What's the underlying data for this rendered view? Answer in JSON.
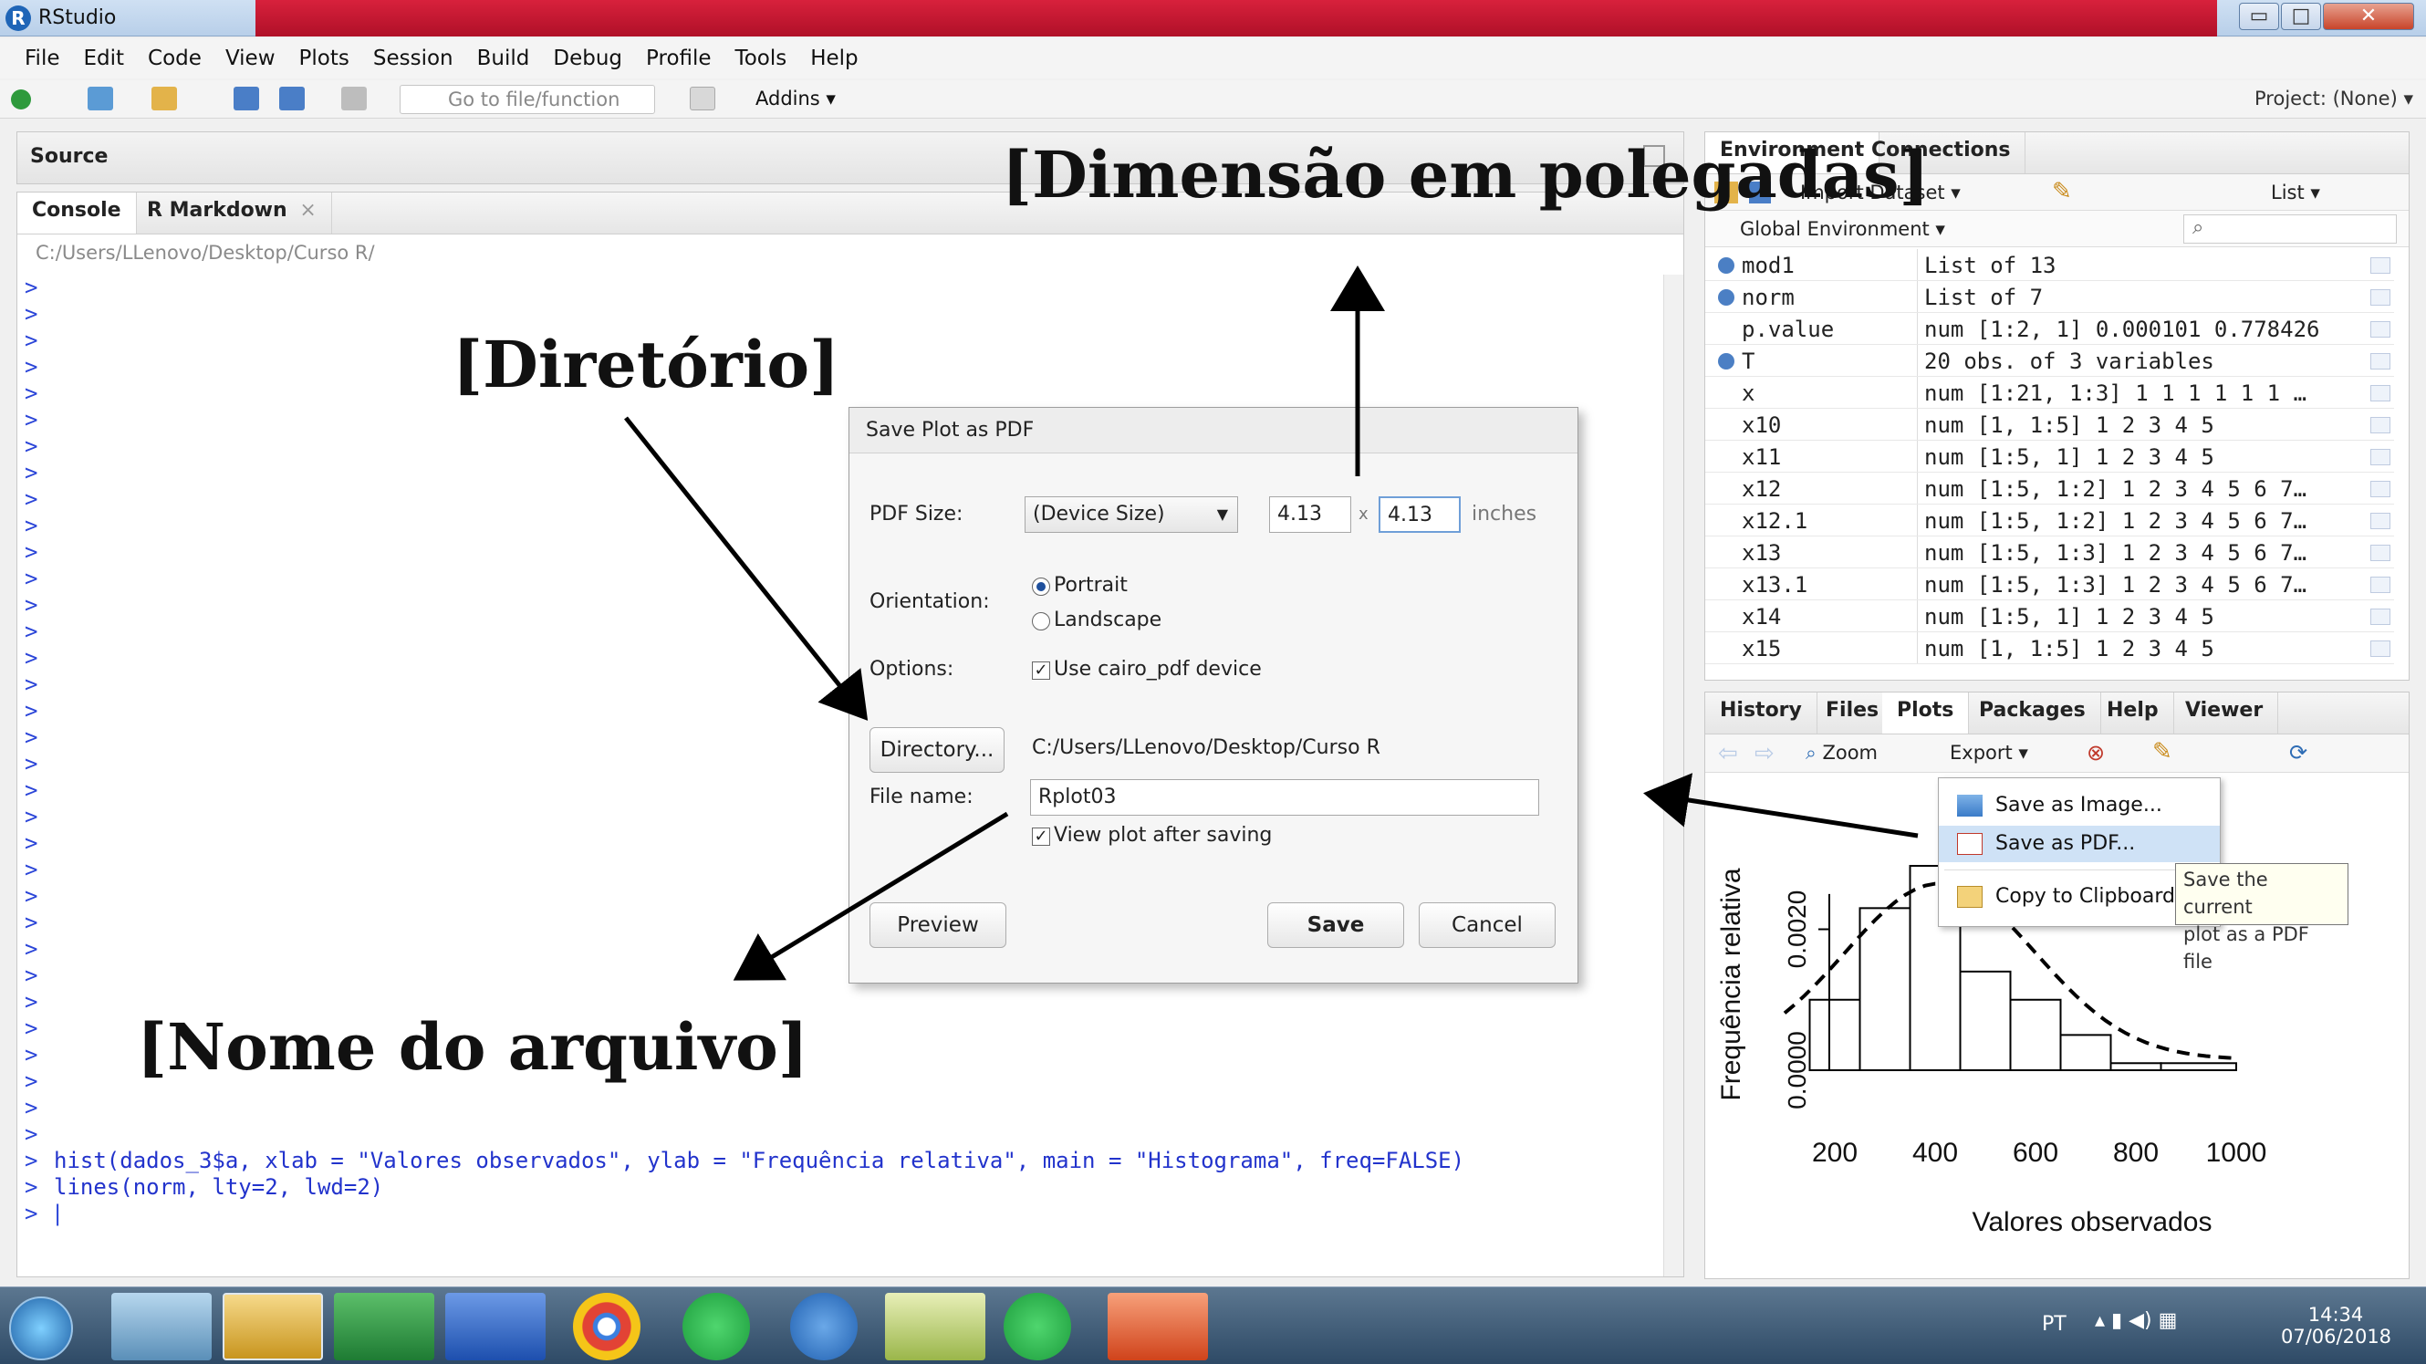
{
  "window": {
    "title": "RStudio",
    "buttons": {
      "minimize": "▭",
      "maximize": "□",
      "close": "✕"
    }
  },
  "menu": [
    "File",
    "Edit",
    "Code",
    "View",
    "Plots",
    "Session",
    "Build",
    "Debug",
    "Profile",
    "Tools",
    "Help"
  ],
  "toolbar": {
    "goto_placeholder": "Go to file/function",
    "addins": "Addins ▾",
    "project": "Project: (None) ▾"
  },
  "source": {
    "title": "Source"
  },
  "console": {
    "tabs": [
      "Console",
      "R Markdown"
    ],
    "path": "C:/Users/LLenovo/Desktop/Curso R/",
    "prompt": ">",
    "commands": [
      "hist(dados_3$a, xlab = \"Valores observados\", ylab = \"Frequência relativa\", main = \"Histograma\", freq=FALSE)",
      "lines(norm, lty=2, lwd=2)"
    ]
  },
  "environment": {
    "tabs": [
      "Environment",
      "Connections"
    ],
    "import": "Import Dataset ▾",
    "list_view": "List ▾",
    "scope": "Global Environment ▾",
    "rows": [
      {
        "name": "mod1",
        "value": "List of 13"
      },
      {
        "name": "norm",
        "value": "List of 7"
      },
      {
        "name": "p.value",
        "value": "num [1:2, 1] 0.000101 0.778426"
      },
      {
        "name": "T",
        "value": "20 obs. of 3 variables"
      },
      {
        "name": "x",
        "value": "num [1:21, 1:3] 1 1 1 1 1 1 …"
      },
      {
        "name": "x10",
        "value": "num [1, 1:5] 1 2 3 4 5"
      },
      {
        "name": "x11",
        "value": "num [1:5, 1] 1 2 3 4 5"
      },
      {
        "name": "x12",
        "value": "num [1:5, 1:2] 1 2 3 4 5 6 7…"
      },
      {
        "name": "x12.1",
        "value": "num [1:5, 1:2] 1 2 3 4 5 6 7…"
      },
      {
        "name": "x13",
        "value": "num [1:5, 1:3] 1 2 3 4 5 6 7…"
      },
      {
        "name": "x13.1",
        "value": "num [1:5, 1:3] 1 2 3 4 5 6 7…"
      },
      {
        "name": "x14",
        "value": "num [1:5, 1] 1 2 3 4 5"
      },
      {
        "name": "x15",
        "value": "num [1, 1:5] 1 2 3 4 5"
      }
    ]
  },
  "plots": {
    "tabs": [
      "History",
      "Files",
      "Plots",
      "Packages",
      "Help",
      "Viewer"
    ],
    "zoom": "Zoom",
    "export": "Export ▾",
    "export_menu": [
      "Save as Image...",
      "Save as PDF...",
      "Copy to Clipboard..."
    ],
    "tooltip": [
      "Save the current",
      "plot as a PDF file"
    ]
  },
  "histogram": {
    "xlabel": "Valores observados",
    "ylabel": "Frequência relativa",
    "xticks": [
      "200",
      "400",
      "600",
      "800",
      "1000"
    ],
    "yticks": [
      "0.0000",
      "0.0020"
    ]
  },
  "dialog": {
    "title": "Save Plot as PDF",
    "pdf_size_label": "PDF Size:",
    "size_option": "(Device Size)",
    "width": "4.13",
    "height": "4.13",
    "x": "x",
    "units": "inches",
    "orientation_label": "Orientation:",
    "portrait": "Portrait",
    "landscape": "Landscape",
    "options_label": "Options:",
    "cairo": "Use cairo_pdf device",
    "directory_button": "Directory...",
    "directory_path": "C:/Users/LLenovo/Desktop/Curso R",
    "filename_label": "File name:",
    "filename": "Rplot03",
    "view_after": "View plot after saving",
    "preview": "Preview",
    "save": "Save",
    "cancel": "Cancel"
  },
  "annotations": {
    "dimensao": "[Dimensão em polegadas]",
    "diretorio": "[Diretório]",
    "nome": "[Nome do arquivo]"
  },
  "taskbar": {
    "lang": "PT",
    "time": "14:34",
    "date": "07/06/2018"
  }
}
